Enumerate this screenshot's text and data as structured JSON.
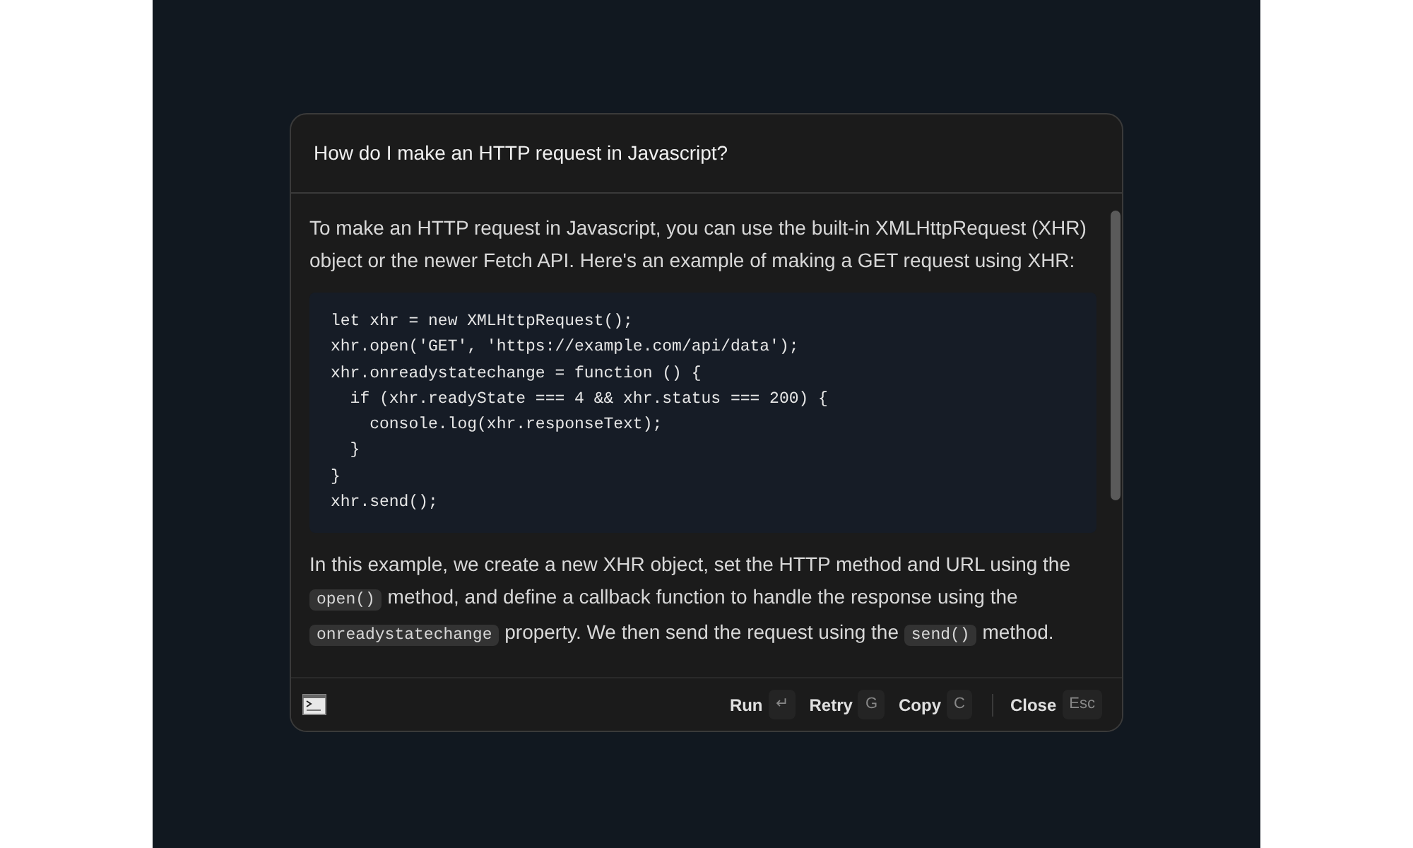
{
  "dialog": {
    "question": "How do I make an HTTP request in Javascript?",
    "answer": {
      "intro": "To make an HTTP request in Javascript, you can use the built-in XMLHttpRequest (XHR) object or the newer Fetch API. Here's an example of making a GET request using XHR:",
      "code_lines": [
        "let xhr = new XMLHttpRequest();",
        "xhr.open('GET', 'https://example.com/api/data');",
        "xhr.onreadystatechange = function () {",
        "  if (xhr.readyState === 4 && xhr.status === 200) {",
        "    console.log(xhr.responseText);",
        "  }",
        "}",
        "xhr.send();"
      ],
      "explanation": [
        {
          "kind": "text",
          "text": "In this example, we create a new XHR object, set the HTTP method and URL using the "
        },
        {
          "kind": "code",
          "text": "open()"
        },
        {
          "kind": "text",
          "text": " method, and define a callback function to handle the response using the "
        },
        {
          "kind": "code",
          "text": "onreadystatechange"
        },
        {
          "kind": "text",
          "text": " property. We then send the request using the "
        },
        {
          "kind": "code",
          "text": "send()"
        },
        {
          "kind": "text",
          "text": " method."
        }
      ]
    },
    "actions": [
      {
        "label": "Run",
        "key": "↵"
      },
      {
        "label": "Retry",
        "key": "G"
      },
      {
        "label": "Copy",
        "key": "C"
      },
      {
        "label": "Close",
        "key": "Esc"
      }
    ]
  }
}
